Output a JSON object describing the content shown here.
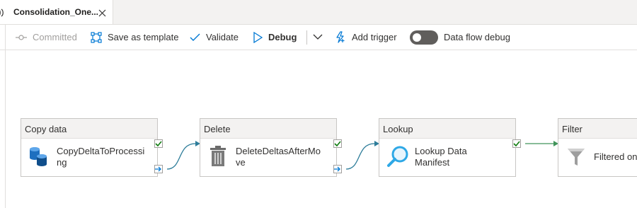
{
  "tab": {
    "title": "Consolidation_One...",
    "close_glyph": "✕"
  },
  "toolbar": {
    "committed_label": "Committed",
    "save_template_label": "Save as template",
    "validate_label": "Validate",
    "debug_label": "Debug",
    "add_trigger_label": "Add trigger",
    "dataflow_debug_label": "Data flow debug",
    "dataflow_debug_on": false
  },
  "activities": [
    {
      "type": "Copy data",
      "name": "CopyDeltaToProcessing",
      "icon": "copy-data-icon"
    },
    {
      "type": "Delete",
      "name": "DeleteDeltasAfterMove",
      "icon": "delete-trash-icon"
    },
    {
      "type": "Lookup",
      "name": "Lookup Data Manifest",
      "icon": "lookup-magnifier-icon"
    },
    {
      "type": "Filter",
      "name": "Filtered on",
      "icon": "filter-funnel-icon"
    }
  ],
  "colors": {
    "success_check": "#107c10",
    "completion_arrow": "#0078d4",
    "connector": "#2e7d9a",
    "success_connector": "#41945a",
    "node_header_bg": "#f3f2f1",
    "toggle_off": "#605e5c"
  }
}
